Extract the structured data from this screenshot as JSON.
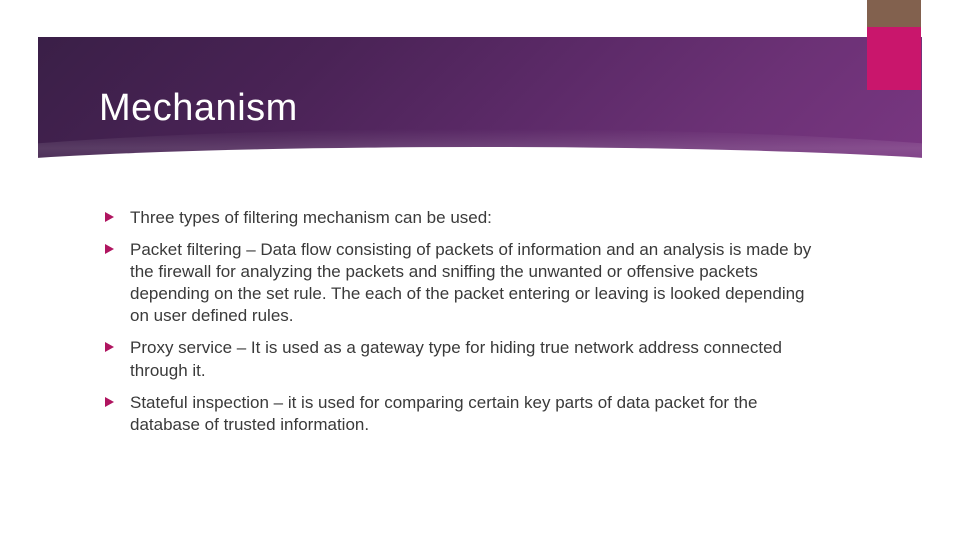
{
  "slide": {
    "title": "Mechanism",
    "bullets": [
      "Three types of filtering mechanism can be used:",
      "Packet filtering – Data flow consisting of packets of information and an analysis is made by the firewall for analyzing the packets and sniffing the unwanted or offensive packets depending on the set rule. The each of the packet entering or leaving is looked depending on user defined rules.",
      "Proxy service – It is used as a gateway type for hiding true network address connected through it.",
      "Stateful inspection – it is used for comparing certain key parts of  data packet for the database of trusted information."
    ]
  },
  "colors": {
    "accent": "#c9166c",
    "headerGradientStart": "#3a1f47",
    "headerGradientEnd": "#7a3782"
  }
}
